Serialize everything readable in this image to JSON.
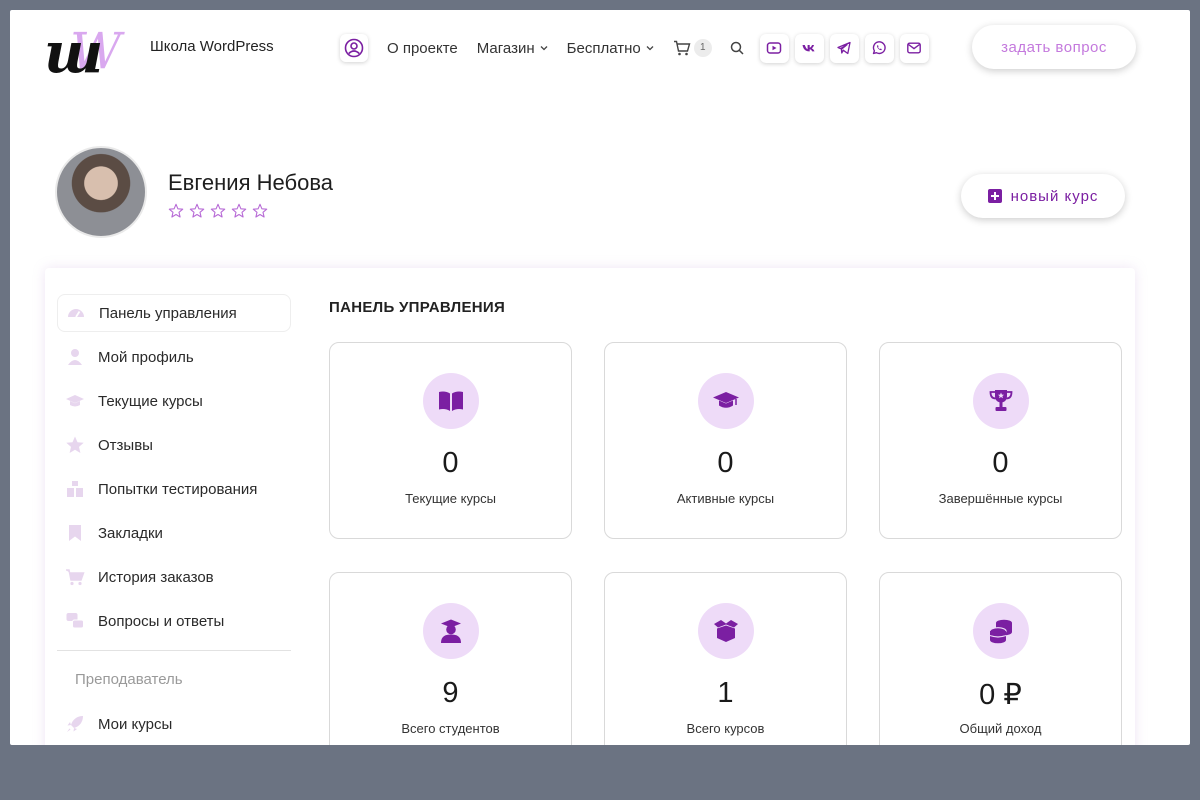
{
  "header": {
    "site_title": "Школа WordPress",
    "logo_text": "шW",
    "nav": [
      {
        "label": "О проекте",
        "dropdown": false
      },
      {
        "label": "Магазин",
        "dropdown": true
      },
      {
        "label": "Бесплатно",
        "dropdown": true
      }
    ],
    "cart_count": "1",
    "socials": [
      "youtube-icon",
      "vk-icon",
      "telegram-icon",
      "whatsapp-icon",
      "mail-icon"
    ],
    "ask_button": "задать вопрос"
  },
  "profile": {
    "name": "Евгения Небова",
    "rating_stars": 5,
    "rating_value": 0,
    "new_course_button": "новый курс"
  },
  "sidebar": {
    "items": [
      {
        "label": "Панель управления",
        "icon": "dashboard-icon",
        "active": true
      },
      {
        "label": "Мой профиль",
        "icon": "user-icon",
        "active": false
      },
      {
        "label": "Текущие курсы",
        "icon": "graduation-cap-icon",
        "active": false
      },
      {
        "label": "Отзывы",
        "icon": "star-icon",
        "active": false
      },
      {
        "label": "Попытки тестирования",
        "icon": "quiz-icon",
        "active": false
      },
      {
        "label": "Закладки",
        "icon": "bookmark-icon",
        "active": false
      },
      {
        "label": "История заказов",
        "icon": "cart-icon",
        "active": false
      },
      {
        "label": "Вопросы и ответы",
        "icon": "qa-icon",
        "active": false
      }
    ],
    "section_label": "Преподаватель",
    "instructor_items": [
      {
        "label": "Мои курсы",
        "icon": "rocket-icon"
      }
    ]
  },
  "dashboard": {
    "title": "ПАНЕЛЬ УПРАВЛЕНИЯ",
    "cards": [
      {
        "value": "0",
        "label": "Текущие курсы",
        "icon": "book-icon"
      },
      {
        "value": "0",
        "label": "Активные курсы",
        "icon": "graduation-cap-icon"
      },
      {
        "value": "0",
        "label": "Завершённые курсы",
        "icon": "trophy-icon"
      },
      {
        "value": "9",
        "label": "Всего студентов",
        "icon": "student-icon"
      },
      {
        "value": "1",
        "label": "Всего курсов",
        "icon": "box-icon"
      },
      {
        "value": "0 ₽",
        "label": "Общий доход",
        "icon": "coins-icon"
      }
    ]
  },
  "colors": {
    "accent": "#7b1fa2",
    "accent_light": "#c479dd",
    "icon_bg": "#eedbf8",
    "backdrop": "#6b7382"
  }
}
